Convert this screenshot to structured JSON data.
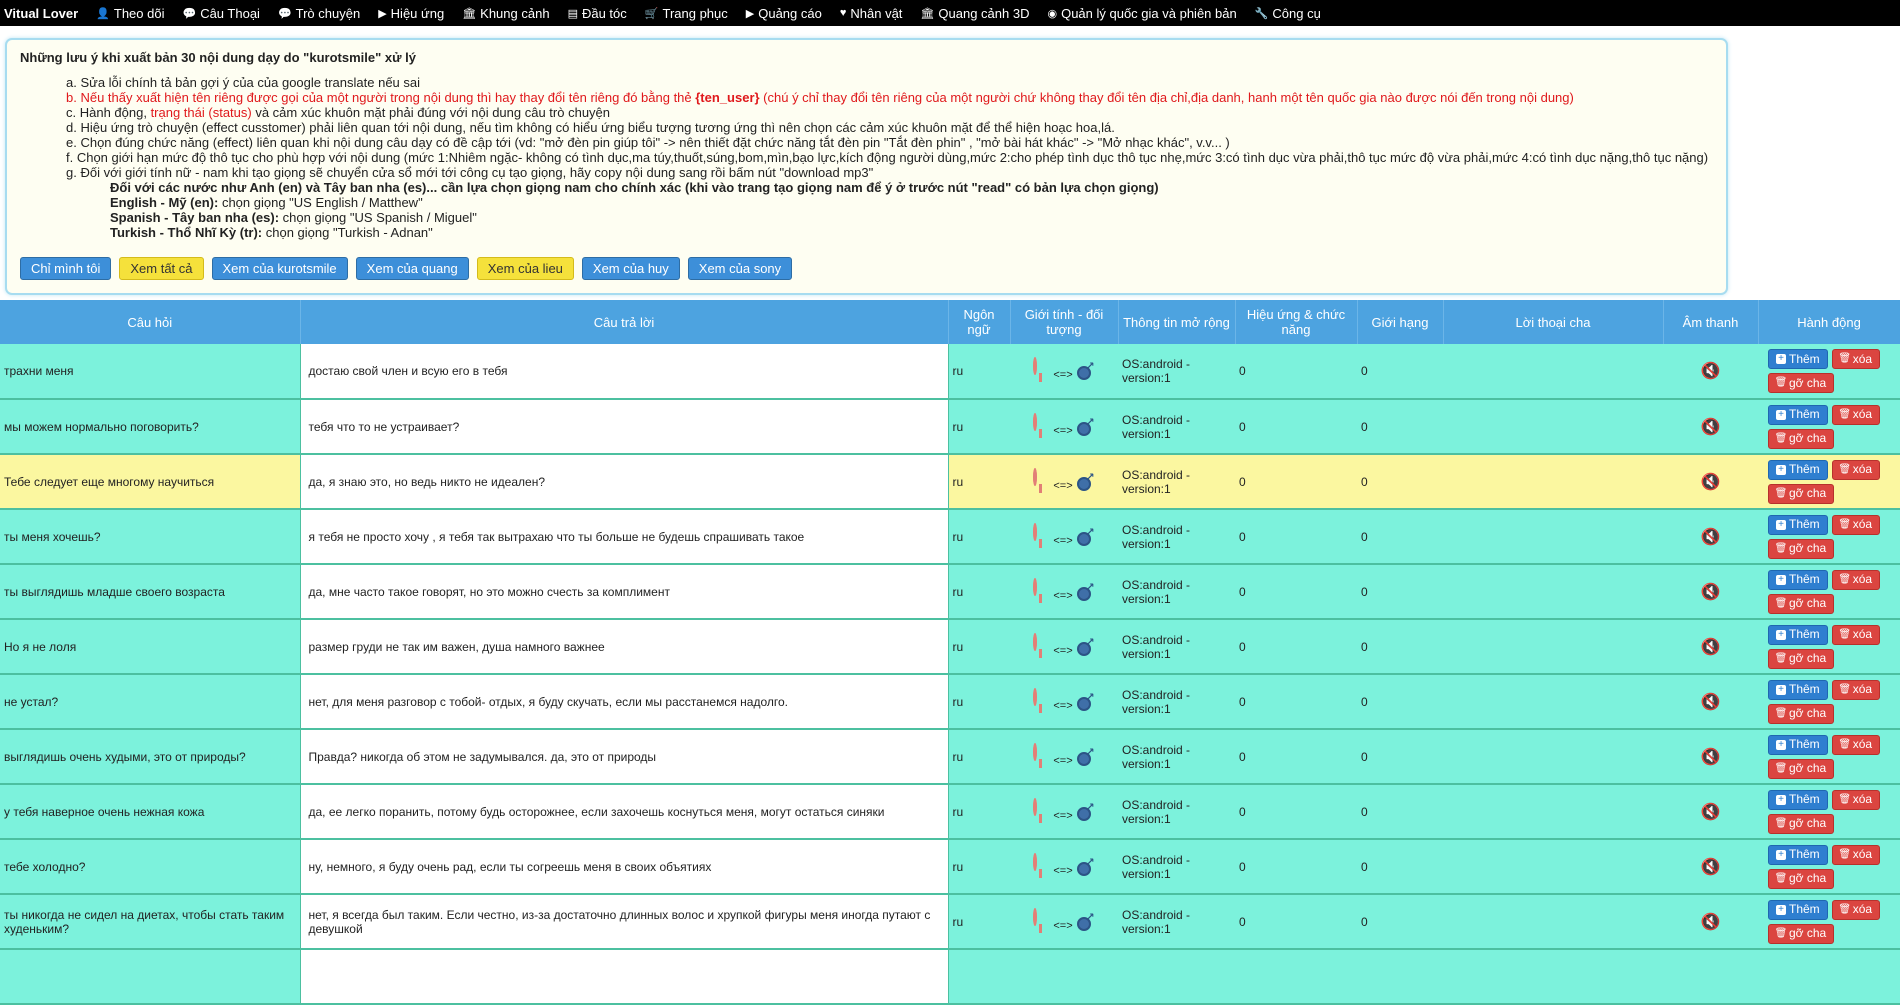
{
  "nav": {
    "brand": "Vitual Lover",
    "items": [
      {
        "icon": "user-icon",
        "glyph": "👤",
        "label": "Theo dõi"
      },
      {
        "icon": "comment-icon",
        "glyph": "💬",
        "label": "Câu Thoại"
      },
      {
        "icon": "comments-icon",
        "glyph": "💬",
        "label": "Trò chuyện"
      },
      {
        "icon": "play-circle-icon",
        "glyph": "▶",
        "label": "Hiệu ứng"
      },
      {
        "icon": "bank-icon",
        "glyph": "🏛",
        "label": "Khung cảnh"
      },
      {
        "icon": "stack-icon",
        "glyph": "▤",
        "label": "Đầu tóc"
      },
      {
        "icon": "cart-icon",
        "glyph": "🛒",
        "label": "Trang phục"
      },
      {
        "icon": "play-circle-icon",
        "glyph": "▶",
        "label": "Quảng cáo"
      },
      {
        "icon": "heart-icon",
        "glyph": "♥",
        "label": "Nhân vật"
      },
      {
        "icon": "bank-icon",
        "glyph": "🏛",
        "label": "Quang cảnh 3D"
      },
      {
        "icon": "globe-icon",
        "glyph": "◉",
        "label": "Quản lý quốc gia và phiên bản"
      },
      {
        "icon": "wrench-icon",
        "glyph": "🔧",
        "label": "Công cụ"
      }
    ]
  },
  "notes": {
    "title": "Những lưu ý khi xuất bản 30 nội dung dạy do \"kurotsmile\" xử lý",
    "items": [
      {
        "prefix": "a. ",
        "text": "Sửa lỗi chính tả bản gợi ý của của google translate nếu sai"
      },
      {
        "prefix": "b. ",
        "text": "Nếu thấy xuất hiện tên riêng được gọi của một người trong nội dung thì hay thay đổi tên riêng đó bằng thẻ ",
        "bold": "{ten_user}",
        "after": " (chú ý chỉ thay đổi tên riêng của một người chứ không thay đổi tên địa chỉ,địa danh, hanh một tên quốc gia nào được nói đến trong nội dung)"
      },
      {
        "prefix": "c. ",
        "text": "Hành động, ",
        "red": "trạng thái (status)",
        "after": " và cảm xúc khuôn mặt phải đúng với nội dung câu trò chuyện"
      },
      {
        "prefix": "d. ",
        "text": "Hiệu ứng trò chuyện (effect cusstomer) phải liên quan tới nội dung, nếu tìm không có hiểu ứng biểu tượng tương ứng thì nên chọn các cảm xúc khuôn mặt để thể hiện hoạc hoa,lá."
      },
      {
        "prefix": "e. ",
        "text": "Chọn đúng chức năng (effect) liên quan khi nội dung câu dạy có đề cập tới (vd: \"mở đèn pin giúp tôi\" -> nên thiết đặt chức năng tắt đèn pin \"Tắt đèn phin\" , \"mở bài hát khác\" -> \"Mở nhạc khác\", v.v... )"
      },
      {
        "prefix": "f. ",
        "text": "Chọn giới hạn mức độ thô tục cho phù hợp với nội dung (mức 1:Nhiêm ngặc- không có tình dục,ma túy,thuốt,súng,bom,mìn,bạo lực,kích động người dùng,mức 2:cho phép tình dục thô tục nhẹ,mức 3:có tình dục vừa phải,thô tục mức độ vừa phải,mức 4:có tình dục nặng,thô tục nặng)"
      },
      {
        "prefix": "g. ",
        "text": "Đối với giới tính nữ - nam khi tạo giọng sẽ chuyển cửa sổ mới tới công cụ tạo giọng, hãy copy nội dung sang rồi bấm nút \"download mp3\""
      }
    ],
    "sub_bold": "Đối với các nước như Anh (en) và Tây ban nha (es)... cần lựa chọn giọng nam cho chính xác (khi vào trang tạo giọng nam để ý ở trước nút \"read\" có bản lựa chọn giọng)",
    "voices": [
      {
        "lang": "English - Mỹ (en):",
        "pick": " chọn giọng \"US English / Matthew\""
      },
      {
        "lang": "Spanish - Tây ban nha (es):",
        "pick": " chọn giọng \"US Spanish / Miguel\""
      },
      {
        "lang": "Turkish - Thổ Nhĩ Kỳ (tr):",
        "pick": " chọn giọng \"Turkish - Adnan\""
      }
    ],
    "buttons": [
      {
        "label": "Chỉ mình tôi",
        "style": "blue"
      },
      {
        "label": "Xem tất cả",
        "style": "yellow"
      },
      {
        "label": "Xem của kurotsmile",
        "style": "blue"
      },
      {
        "label": "Xem của quang",
        "style": "blue"
      },
      {
        "label": "Xem của lieu",
        "style": "yellow"
      },
      {
        "label": "Xem của huy",
        "style": "blue"
      },
      {
        "label": "Xem của sony",
        "style": "blue"
      }
    ]
  },
  "table": {
    "headers": [
      "Câu hỏi",
      "Câu trả lời",
      "Ngôn ngữ",
      "Giới tính - đối tượng",
      "Thông tin mở rộng",
      "Hiệu ứng & chức năng",
      "Giới hạng",
      "Lời thoại cha",
      "Âm thanh",
      "Hành động"
    ],
    "gender_sep": "<=>",
    "btn_add": "Thêm",
    "btn_del": "xóa",
    "btn_unparent": "gỡ cha",
    "rows": [
      {
        "q": "трахни меня",
        "a": "достаю свой член и всую его в тебя",
        "lang": "ru",
        "info": "OS:android - version:1",
        "effect": "0",
        "limit": "0",
        "hl": false
      },
      {
        "q": "мы можем нормально поговорить?",
        "a": "тебя что то не устраивает?",
        "lang": "ru",
        "info": "OS:android - version:1",
        "effect": "0",
        "limit": "0",
        "hl": false
      },
      {
        "q": "Тебе следует еще многому научиться",
        "a": "да, я знаю это, но ведь никто не идеален?",
        "lang": "ru",
        "info": "OS:android - version:1",
        "effect": "0",
        "limit": "0",
        "hl": true
      },
      {
        "q": "ты меня хочешь?",
        "a": "я тебя не просто хочу , я тебя так вытрахаю что ты больше не будешь спрашивать такое",
        "lang": "ru",
        "info": "OS:android - version:1",
        "effect": "0",
        "limit": "0",
        "hl": false
      },
      {
        "q": "ты выглядишь младше своего возраста",
        "a": "да, мне часто такое говорят, но это можно счесть за комплимент",
        "lang": "ru",
        "info": "OS:android - version:1",
        "effect": "0",
        "limit": "0",
        "hl": false
      },
      {
        "q": "Но я не лоля",
        "a": "размер груди не так им важен, душа намного важнее",
        "lang": "ru",
        "info": "OS:android - version:1",
        "effect": "0",
        "limit": "0",
        "hl": false
      },
      {
        "q": "не устал?",
        "a": "нет, для меня разговор с тобой- отдых, я буду скучать, если мы расстанемся надолго.",
        "lang": "ru",
        "info": "OS:android - version:1",
        "effect": "0",
        "limit": "0",
        "hl": false
      },
      {
        "q": "выглядишь очень худыми, это от природы?",
        "a": "Правда? никогда об этом не задумывался. да, это от природы",
        "lang": "ru",
        "info": "OS:android - version:1",
        "effect": "0",
        "limit": "0",
        "hl": false
      },
      {
        "q": "у тебя наверное очень нежная кожа",
        "a": "да, ее легко поранить, потому будь осторожнее, если захочешь коснуться меня, могут остаться синяки",
        "lang": "ru",
        "info": "OS:android - version:1",
        "effect": "0",
        "limit": "0",
        "hl": false
      },
      {
        "q": "тебе холодно?",
        "a": "ну, немного, я буду очень рад, если ты согреешь меня в своих объятиях",
        "lang": "ru",
        "info": "OS:android - version:1",
        "effect": "0",
        "limit": "0",
        "hl": false
      },
      {
        "q": "ты никогда не сидел на диетах, чтобы стать таким худеньким?",
        "a": "нет, я всегда был таким. Если честно, из-за достаточно длинных волос и хрупкой фигуры меня иногда путают с девушкой",
        "lang": "ru",
        "info": "OS:android - version:1",
        "effect": "0",
        "limit": "0",
        "hl": false
      },
      {
        "q": "",
        "a": "",
        "lang": "",
        "info": "",
        "effect": "",
        "limit": "",
        "hl": false
      }
    ]
  }
}
